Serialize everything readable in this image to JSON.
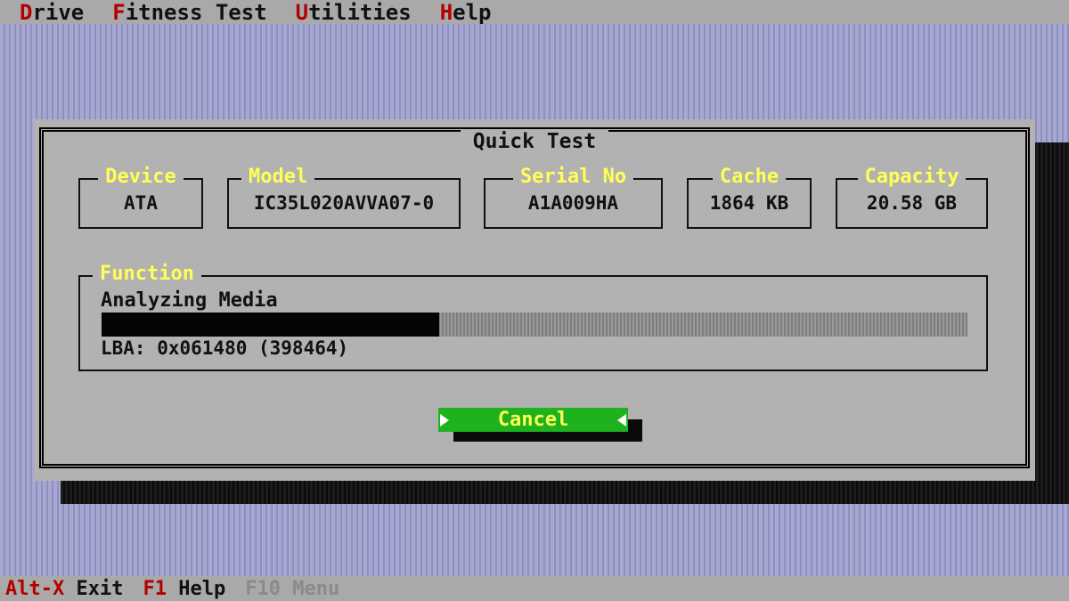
{
  "menu": [
    {
      "hotkey": "D",
      "rest": "rive"
    },
    {
      "hotkey": "F",
      "rest": "itness Test"
    },
    {
      "hotkey": "U",
      "rest": "tilities"
    },
    {
      "hotkey": "H",
      "rest": "elp"
    }
  ],
  "dialog": {
    "title": "Quick Test",
    "fields": {
      "device": {
        "label": "Device",
        "value": "ATA"
      },
      "model": {
        "label": "Model",
        "value": "IC35L020AVVA07-0"
      },
      "serial": {
        "label": "Serial No",
        "value": "A1A009HA"
      },
      "cache": {
        "label": "Cache",
        "value": "1864 KB"
      },
      "capacity": {
        "label": "Capacity",
        "value": "20.58 GB"
      }
    },
    "function": {
      "label": "Function",
      "status": "Analyzing Media",
      "progress_percent": 39,
      "lba": "LBA: 0x061480 (398464)"
    },
    "cancel_label": "Cancel"
  },
  "statusbar": [
    {
      "key": "Alt-X",
      "label": "Exit"
    },
    {
      "key": "F1",
      "label": "Help"
    },
    {
      "key": "F10",
      "label": "Menu"
    }
  ],
  "colors": {
    "desktop": "#9c9cc8",
    "dialog": "#b2b2b2",
    "label_yellow": "#ffff55",
    "hotkey_red": "#b40000",
    "button_green": "#1eb21e"
  }
}
